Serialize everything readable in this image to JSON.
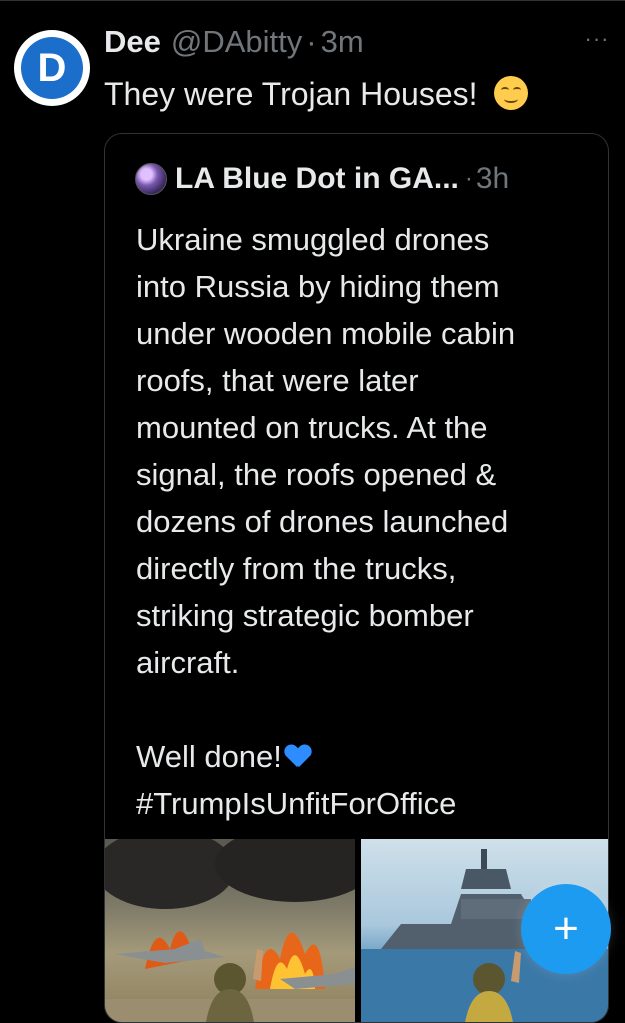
{
  "tweet": {
    "avatar_letter": "D",
    "author_name": "Dee",
    "author_handle": "@DAbitty",
    "separator": "·",
    "time": "3m",
    "text": "They were Trojan Houses!",
    "emoji": "smiling-face-icon"
  },
  "more_label": "···",
  "quoted": {
    "author_name": "LA Blue Dot in GA...",
    "separator": "·",
    "time": "3h",
    "lines": [
      "Ukraine smuggled drones",
      "into Russia by hiding them",
      "under wooden mobile cabin",
      "roofs, that were later",
      "mounted on trucks.  At the",
      "signal, the roofs opened &",
      "dozens of drones launched",
      "directly from the trucks,",
      "striking strategic bomber",
      "aircraft."
    ],
    "closing": "Well done!",
    "hashtag": "#TrumpIsUnfitForOffice"
  },
  "fab_label": "+",
  "colors": {
    "background": "#000000",
    "text": "#e7e9ea",
    "muted": "#71767b",
    "accent": "#1d9bf0",
    "border": "#2f3336"
  }
}
